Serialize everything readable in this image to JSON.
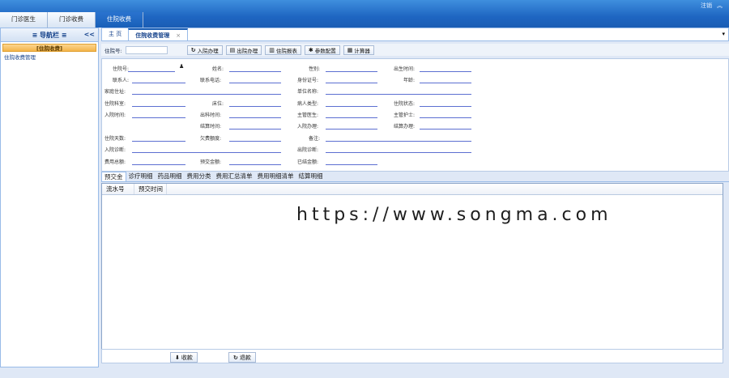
{
  "top": {
    "tabs": [
      {
        "label": "门诊医生",
        "active": false
      },
      {
        "label": "门诊收费",
        "active": false
      },
      {
        "label": "住院收费",
        "active": true
      }
    ],
    "right_links": [
      "注",
      "销"
    ]
  },
  "nav": {
    "title": "导航栏",
    "collapse_label": "<<",
    "group": "[住院收费]",
    "items": [
      "住院收费管理"
    ]
  },
  "main_tabs": [
    {
      "label": "主 页",
      "active": false
    },
    {
      "label": "住院收费管理",
      "active": true,
      "close": "×"
    }
  ],
  "toolbar": {
    "zyh_label": "住院号:",
    "buttons": [
      {
        "icon": "↻",
        "label": "入院办理"
      },
      {
        "icon": "▤",
        "label": "出院办理"
      },
      {
        "icon": "▥",
        "label": "住院报表"
      },
      {
        "icon": "✱",
        "label": "参数配置"
      },
      {
        "icon": "▦",
        "label": "计算器"
      }
    ]
  },
  "form": {
    "zyh": "住院号:",
    "xm": "姓名:",
    "xb": "性别:",
    "csrq": "出生时间:",
    "lxr": "联系人:",
    "lxdh": "联系电话:",
    "sfzh": "身份证号:",
    "nl": "年龄:",
    "jtzz": "家庭住址:",
    "dwmc": "单位名称:",
    "zyks": "住院科室:",
    "cw": "床位:",
    "brlx": "病人类型:",
    "zyzt": "住院状态:",
    "rysj": "入院时间:",
    "cysj": "出科时间:",
    "zgys": "主管医生:",
    "zghs": "主管护士:",
    "jssj": "结算时间:",
    "rybl": "入院办理:",
    "jsbl": "结算办理:",
    "zyts": "住院天数:",
    "qfxe": "欠费额度:",
    "bz": "备注:",
    "ryzd": "入院诊断:",
    "cyzd": "出院诊断:",
    "fyze": "费用总额:",
    "yjje": "预交金额:",
    "yjsje": "已结金额:"
  },
  "detail_tabs": [
    {
      "label": "预交金",
      "active": true
    },
    {
      "label": "诊疗明细",
      "active": false
    },
    {
      "label": "药品明细",
      "active": false
    },
    {
      "label": "费用分类",
      "active": false
    },
    {
      "label": "费用汇总清单",
      "active": false
    },
    {
      "label": "费用明细清单",
      "active": false
    },
    {
      "label": "结算明细",
      "active": false
    }
  ],
  "grid": {
    "columns": [
      "流水号",
      "预交时间"
    ]
  },
  "watermark": "https://www.songma.com",
  "bottom": {
    "collect": {
      "icon": "⬇",
      "label": "收款"
    },
    "refund": {
      "icon": "↻",
      "label": "退款"
    }
  }
}
